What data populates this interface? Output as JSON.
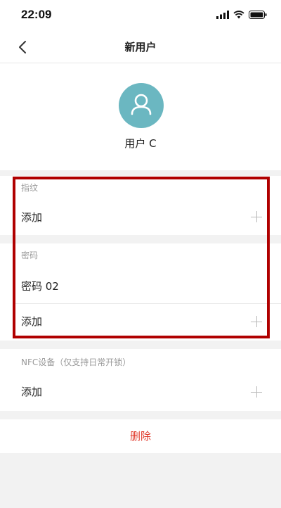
{
  "status_bar": {
    "time": "22:09",
    "icons": [
      "signal-icon",
      "wifi-icon",
      "battery-icon"
    ]
  },
  "nav": {
    "title": "新用户",
    "back_icon": "chevron-left-icon"
  },
  "profile": {
    "name": "用户 C",
    "avatar_color": "#6bb7c1"
  },
  "fingerprint": {
    "title": "指纹",
    "add_label": "添加"
  },
  "password": {
    "title": "密码",
    "items": [
      "密码 02"
    ],
    "add_label": "添加"
  },
  "nfc": {
    "title": "NFC设备（仅支持日常开锁）",
    "add_label": "添加"
  },
  "delete_label": "删除",
  "colors": {
    "highlight": "#b00000",
    "delete": "#e0392b",
    "accent": "#6bb7c1"
  }
}
